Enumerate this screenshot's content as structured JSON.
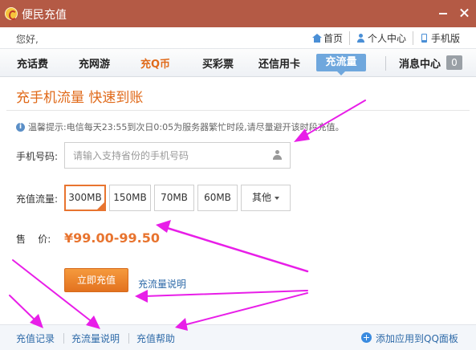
{
  "window": {
    "title": "便民充值"
  },
  "topbar": {
    "greeting": "您好,",
    "links": [
      {
        "label": "首页",
        "icon": "home-icon"
      },
      {
        "label": "个人中心",
        "icon": "user-icon"
      },
      {
        "label": "手机版",
        "icon": "phone-icon"
      }
    ]
  },
  "nav": {
    "items": [
      "充话费",
      "充网游",
      "充Q币",
      "买彩票",
      "还信用卡",
      "充流量"
    ],
    "active": "充流量",
    "message_center": "消息中心",
    "message_count": "0"
  },
  "main": {
    "headline": "充手机流量 快速到账",
    "tip": "温馨提示:电信每天23:55到次日0:05为服务器繁忙时段,请尽量避开该时段充值。",
    "phone_label": "手机号码:",
    "phone_placeholder": "请输入支持省份的手机号码",
    "flow_label": "充值流量:",
    "flow_options": [
      "300MB",
      "150MB",
      "70MB",
      "60MB",
      "其他"
    ],
    "flow_selected": "300MB",
    "price_label": "售    价:",
    "price": "¥99.00-99.50",
    "pay_button": "立即充值",
    "flow_info_link": "充流量说明"
  },
  "footer": {
    "links": [
      "充值记录",
      "充流量说明",
      "充值帮助"
    ],
    "add_app": "添加应用到QQ面板"
  },
  "colors": {
    "titlebar": "#b45a45",
    "accent": "#e8742f",
    "link": "#2e6aa8",
    "annotation": "#e81ee8"
  }
}
